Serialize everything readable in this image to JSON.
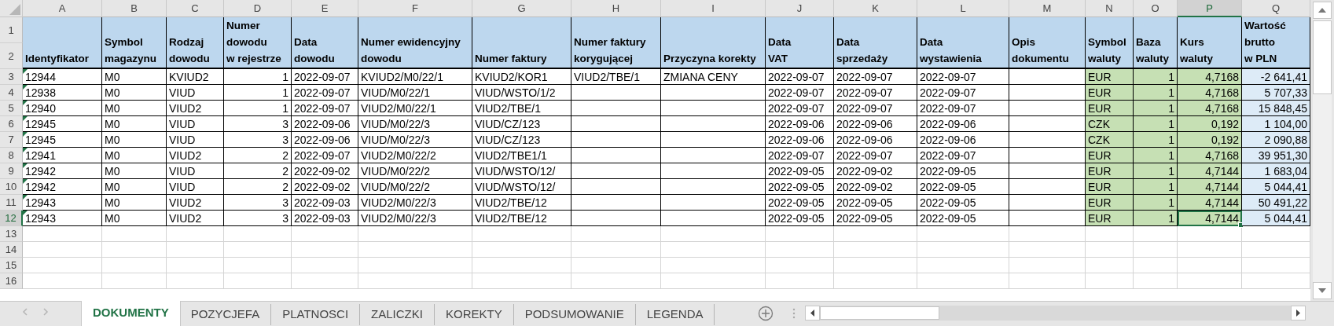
{
  "column_letters": [
    {
      "letter": "A",
      "selected": false
    },
    {
      "letter": "B",
      "selected": false
    },
    {
      "letter": "C",
      "selected": false
    },
    {
      "letter": "D",
      "selected": false
    },
    {
      "letter": "E",
      "selected": false
    },
    {
      "letter": "F",
      "selected": false
    },
    {
      "letter": "G",
      "selected": false
    },
    {
      "letter": "H",
      "selected": false
    },
    {
      "letter": "I",
      "selected": false
    },
    {
      "letter": "J",
      "selected": false
    },
    {
      "letter": "K",
      "selected": false
    },
    {
      "letter": "L",
      "selected": false
    },
    {
      "letter": "M",
      "selected": false
    },
    {
      "letter": "N",
      "selected": false
    },
    {
      "letter": "O",
      "selected": false
    },
    {
      "letter": "P",
      "selected": true
    },
    {
      "letter": "Q",
      "selected": false
    }
  ],
  "header_row_numbers": [
    "1",
    "2"
  ],
  "columns": [
    {
      "header": "Identyfikator",
      "kind": "text",
      "color": "#ffffff"
    },
    {
      "header": "Symbol\nmagazynu",
      "kind": "text",
      "color": "#ffffff"
    },
    {
      "header": "Rodzaj\ndowodu",
      "kind": "text",
      "color": "#ffffff"
    },
    {
      "header": "Numer\ndowodu\nw rejestrze",
      "kind": "number",
      "color": "#ffffff"
    },
    {
      "header": "Data\ndowodu",
      "kind": "text",
      "color": "#ffffff"
    },
    {
      "header": "Numer ewidencyjny\ndowodu",
      "kind": "text",
      "color": "#ffffff"
    },
    {
      "header": "Numer faktury",
      "kind": "text",
      "color": "#ffffff"
    },
    {
      "header": "Numer faktury\nkorygującej",
      "kind": "text",
      "color": "#ffffff"
    },
    {
      "header": "Przyczyna korekty",
      "kind": "text",
      "color": "#ffffff"
    },
    {
      "header": "Data\nVAT",
      "kind": "text",
      "color": "#ffffff"
    },
    {
      "header": "Data\nsprzedaży",
      "kind": "text",
      "color": "#ffffff"
    },
    {
      "header": "Data\nwystawienia",
      "kind": "text",
      "color": "#ffffff"
    },
    {
      "header": "Opis\ndokumentu",
      "kind": "text",
      "color": "#ffffff"
    },
    {
      "header": "Symbol\nwaluty",
      "kind": "text",
      "color": "#c6e0b4"
    },
    {
      "header": "Baza\nwaluty",
      "kind": "number",
      "color": "#c6e0b4"
    },
    {
      "header": "Kurs\nwaluty",
      "kind": "number",
      "color": "#c6e0b4"
    },
    {
      "header": "Wartość\nbrutto\nw PLN",
      "kind": "number",
      "color": "#ddebf7"
    }
  ],
  "rows": [
    {
      "number": "3",
      "flagged": true,
      "selected": false,
      "cells": [
        "12944",
        "M0",
        "KVIUD2",
        "1",
        "2022-09-07",
        "KVIUD2/M0/22/1",
        "KVIUD2/KOR1",
        "VIUD2/TBE/1",
        "ZMIANA CENY",
        "2022-09-07",
        "2022-09-07",
        "2022-09-07",
        null,
        "EUR",
        "1",
        "4,7168",
        "-2 641,41"
      ]
    },
    {
      "number": "4",
      "flagged": true,
      "selected": false,
      "cells": [
        "12938",
        "M0",
        "VIUD",
        "1",
        "2022-09-07",
        "VIUD/M0/22/1",
        "VIUD/WSTO/1/2",
        null,
        null,
        "2022-09-07",
        "2022-09-07",
        "2022-09-07",
        null,
        "EUR",
        "1",
        "4,7168",
        "5 707,33"
      ]
    },
    {
      "number": "5",
      "flagged": true,
      "selected": false,
      "cells": [
        "12940",
        "M0",
        "VIUD2",
        "1",
        "2022-09-07",
        "VIUD2/M0/22/1",
        "VIUD2/TBE/1",
        null,
        null,
        "2022-09-07",
        "2022-09-07",
        "2022-09-07",
        null,
        "EUR",
        "1",
        "4,7168",
        "15 848,45"
      ]
    },
    {
      "number": "6",
      "flagged": true,
      "selected": false,
      "cells": [
        "12945",
        "M0",
        "VIUD",
        "3",
        "2022-09-06",
        "VIUD/M0/22/3",
        "VIUD/CZ/123",
        null,
        null,
        "2022-09-06",
        "2022-09-06",
        "2022-09-06",
        null,
        "CZK",
        "1",
        "0,192",
        "1 104,00"
      ]
    },
    {
      "number": "7",
      "flagged": true,
      "selected": false,
      "cells": [
        "12945",
        "M0",
        "VIUD",
        "3",
        "2022-09-06",
        "VIUD/M0/22/3",
        "VIUD/CZ/123",
        null,
        null,
        "2022-09-06",
        "2022-09-06",
        "2022-09-06",
        null,
        "CZK",
        "1",
        "0,192",
        "2 090,88"
      ]
    },
    {
      "number": "8",
      "flagged": true,
      "selected": false,
      "cells": [
        "12941",
        "M0",
        "VIUD2",
        "2",
        "2022-09-07",
        "VIUD2/M0/22/2",
        "VIUD2/TBE1/1",
        null,
        null,
        "2022-09-07",
        "2022-09-07",
        "2022-09-07",
        null,
        "EUR",
        "1",
        "4,7168",
        "39 951,30"
      ]
    },
    {
      "number": "9",
      "flagged": true,
      "selected": false,
      "cells": [
        "12942",
        "M0",
        "VIUD",
        "2",
        "2022-09-02",
        "VIUD/M0/22/2",
        "VIUD/WSTO/12/",
        null,
        null,
        "2022-09-05",
        "2022-09-02",
        "2022-09-05",
        null,
        "EUR",
        "1",
        "4,7144",
        "1 683,04"
      ]
    },
    {
      "number": "10",
      "flagged": true,
      "selected": false,
      "cells": [
        "12942",
        "M0",
        "VIUD",
        "2",
        "2022-09-02",
        "VIUD/M0/22/2",
        "VIUD/WSTO/12/",
        null,
        null,
        "2022-09-05",
        "2022-09-02",
        "2022-09-05",
        null,
        "EUR",
        "1",
        "4,7144",
        "5 044,41"
      ]
    },
    {
      "number": "11",
      "flagged": true,
      "selected": false,
      "cells": [
        "12943",
        "M0",
        "VIUD2",
        "3",
        "2022-09-03",
        "VIUD2/M0/22/3",
        "VIUD2/TBE/12",
        null,
        null,
        "2022-09-05",
        "2022-09-05",
        "2022-09-05",
        null,
        "EUR",
        "1",
        "4,7144",
        "50 491,22"
      ]
    },
    {
      "number": "12",
      "flagged": true,
      "selected": true,
      "cells": [
        "12943",
        "M0",
        "VIUD2",
        "3",
        "2022-09-03",
        "VIUD2/M0/22/3",
        "VIUD2/TBE/12",
        null,
        null,
        "2022-09-05",
        "2022-09-05",
        "2022-09-05",
        null,
        "EUR",
        "1",
        "4,7144",
        "5 044,41"
      ]
    }
  ],
  "empty_rows": [
    "13",
    "14",
    "15",
    "16"
  ],
  "sheet_tabs": [
    {
      "label": "DOKUMENTY",
      "selected": true
    },
    {
      "label": "POZYCJEFA",
      "selected": false
    },
    {
      "label": "PLATNOSCI",
      "selected": false
    },
    {
      "label": "ZALICZKI",
      "selected": false
    },
    {
      "label": "KOREKTY",
      "selected": false
    },
    {
      "label": "PODSUMOWANIE",
      "selected": false
    },
    {
      "label": "LEGENDA",
      "selected": false
    }
  ]
}
